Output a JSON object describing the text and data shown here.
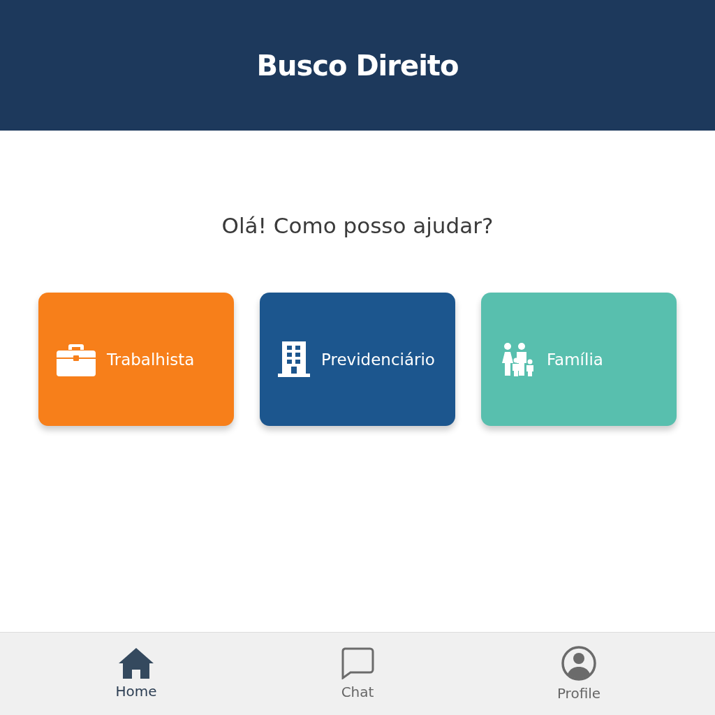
{
  "header": {
    "logo": "Busco Direito"
  },
  "greeting": "Olá! Como posso ajudar?",
  "categories": [
    {
      "label": "Trabalhista",
      "kind": "briefcase",
      "color": "#f77f1a"
    },
    {
      "label": "Previdenciário",
      "kind": "building",
      "color": "#1c568e"
    },
    {
      "label": "Família",
      "kind": "family",
      "color": "#58bfae"
    }
  ],
  "nav": [
    {
      "label": "Home",
      "kind": "home",
      "selected": true
    },
    {
      "label": "Chat",
      "kind": "chat",
      "selected": false
    },
    {
      "label": "Profile",
      "kind": "profile",
      "selected": false
    }
  ]
}
